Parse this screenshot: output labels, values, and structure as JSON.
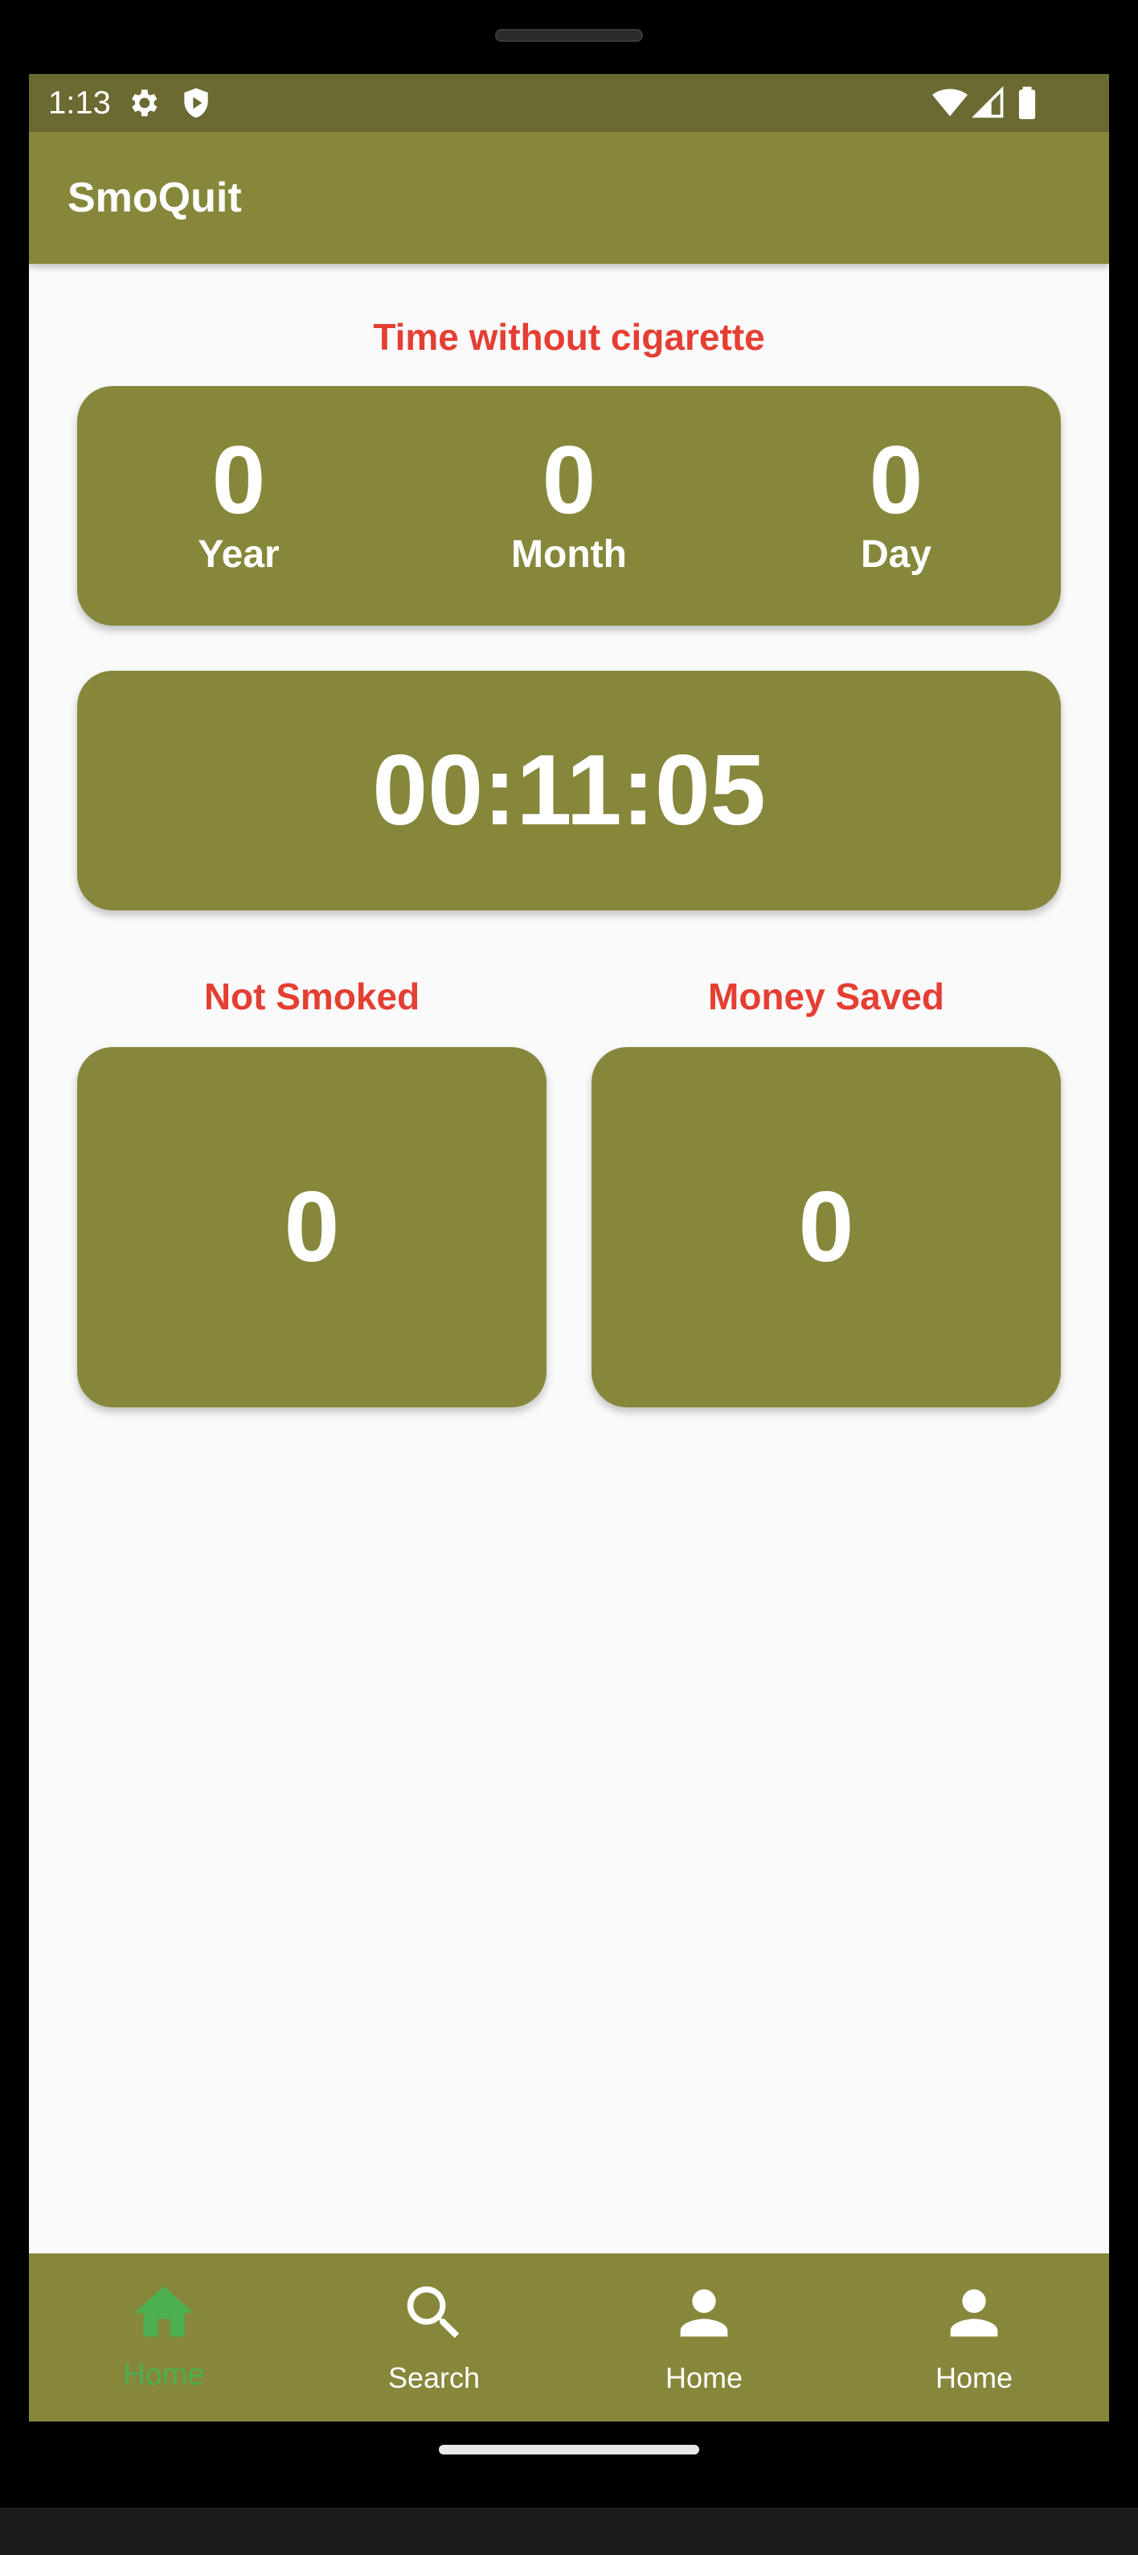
{
  "status_bar": {
    "time": "1:13",
    "icons": [
      "gear-icon",
      "shield-icon",
      "wifi-icon",
      "signal-icon",
      "battery-icon"
    ]
  },
  "app_bar": {
    "title": "SmoQuit"
  },
  "time_without": {
    "title": "Time without cigarette",
    "year_value": "0",
    "year_label": "Year",
    "month_value": "0",
    "month_label": "Month",
    "day_value": "0",
    "day_label": "Day",
    "clock": "00:11:05"
  },
  "stats": {
    "not_smoked_title": "Not Smoked",
    "not_smoked_value": "0",
    "money_saved_title": "Money Saved",
    "money_saved_value": "0"
  },
  "bottom_nav": {
    "items": [
      {
        "label": "Home",
        "icon": "home-icon",
        "active": true
      },
      {
        "label": "Search",
        "icon": "search-icon",
        "active": false
      },
      {
        "label": "Home",
        "icon": "person-icon",
        "active": false
      },
      {
        "label": "Home",
        "icon": "person-icon",
        "active": false
      }
    ]
  },
  "colors": {
    "primary": "#87873c",
    "status_bar": "#6b6a32",
    "accent_text": "#e53e33",
    "active_nav": "#4caf50",
    "background": "#fafafa"
  }
}
